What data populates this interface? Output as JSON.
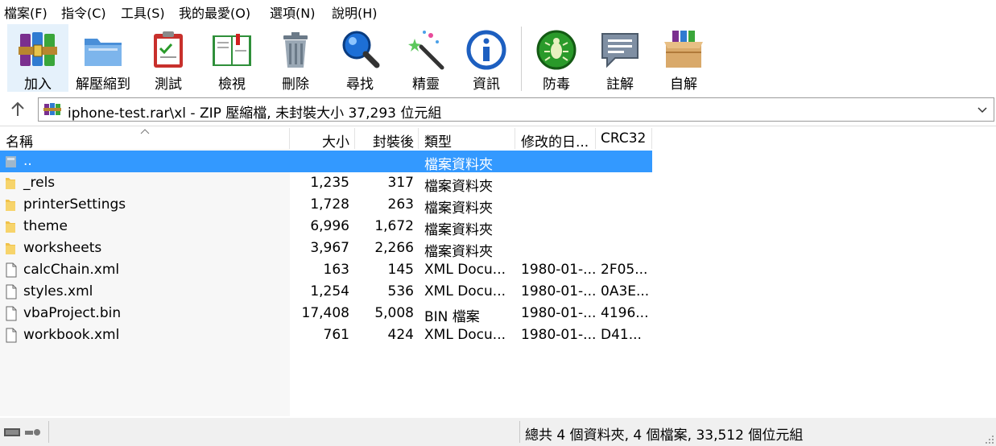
{
  "menu": [
    "檔案(F)",
    "指令(C)",
    "工具(S)",
    "我的最愛(O)",
    "選項(N)",
    "說明(H)"
  ],
  "toolbar": [
    {
      "label": "加入",
      "icon": "add-archive-icon"
    },
    {
      "label": "解壓縮到",
      "icon": "extract-folder-icon"
    },
    {
      "label": "測試",
      "icon": "test-clipboard-icon"
    },
    {
      "label": "檢視",
      "icon": "view-book-icon"
    },
    {
      "label": "刪除",
      "icon": "trash-can-icon"
    },
    {
      "label": "尋找",
      "icon": "magnifier-icon"
    },
    {
      "label": "精靈",
      "icon": "wizard-wand-icon"
    },
    {
      "label": "資訊",
      "icon": "info-icon"
    },
    {
      "label": "防毒",
      "icon": "virus-scan-icon"
    },
    {
      "label": "註解",
      "icon": "comment-bubble-icon"
    },
    {
      "label": "自解",
      "icon": "sfx-box-icon"
    }
  ],
  "address": {
    "path": "iphone-test.rar\\xl - ZIP 壓縮檔, 未封裝大小 37,293 位元組"
  },
  "columns": {
    "name": "名稱",
    "size": "大小",
    "packed": "封裝後",
    "type": "類型",
    "modified": "修改的日...",
    "crc": "CRC32"
  },
  "files": [
    {
      "name": "..",
      "size": "",
      "packed": "",
      "type": "檔案資料夾",
      "modified": "",
      "crc": "",
      "kind": "up",
      "selected": true
    },
    {
      "name": "_rels",
      "size": "1,235",
      "packed": "317",
      "type": "檔案資料夾",
      "modified": "",
      "crc": "",
      "kind": "folder"
    },
    {
      "name": "printerSettings",
      "size": "1,728",
      "packed": "263",
      "type": "檔案資料夾",
      "modified": "",
      "crc": "",
      "kind": "folder"
    },
    {
      "name": "theme",
      "size": "6,996",
      "packed": "1,672",
      "type": "檔案資料夾",
      "modified": "",
      "crc": "",
      "kind": "folder"
    },
    {
      "name": "worksheets",
      "size": "3,967",
      "packed": "2,266",
      "type": "檔案資料夾",
      "modified": "",
      "crc": "",
      "kind": "folder"
    },
    {
      "name": "calcChain.xml",
      "size": "163",
      "packed": "145",
      "type": "XML Docu...",
      "modified": "1980-01-...",
      "crc": "2F05...",
      "kind": "file"
    },
    {
      "name": "styles.xml",
      "size": "1,254",
      "packed": "536",
      "type": "XML Docu...",
      "modified": "1980-01-...",
      "crc": "0A3E...",
      "kind": "file"
    },
    {
      "name": "vbaProject.bin",
      "size": "17,408",
      "packed": "5,008",
      "type": "BIN 檔案",
      "modified": "1980-01-...",
      "crc": "4196...",
      "kind": "file"
    },
    {
      "name": "workbook.xml",
      "size": "761",
      "packed": "424",
      "type": "XML Docu...",
      "modified": "1980-01-...",
      "crc": "D41...",
      "kind": "file"
    }
  ],
  "status": {
    "summary": "總共 4 個資料夾, 4 個檔案, 33,512 個位元組"
  },
  "colors": {
    "selection": "#3399ff",
    "folder": "#f0c24b"
  }
}
